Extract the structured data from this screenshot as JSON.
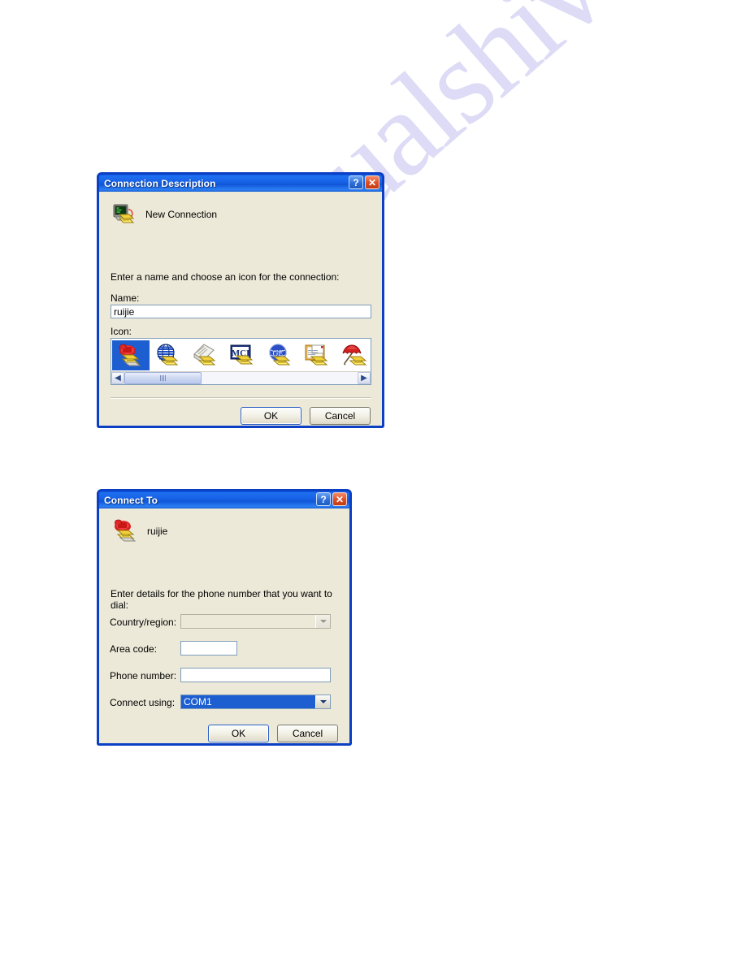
{
  "page": {
    "watermark": "manualshive.com",
    "background_color": "#ffffff"
  },
  "theme": {
    "titlebar_blue": "#1763e8",
    "dialog_face": "#ece9d8",
    "frame_blue": "#0b3fc4",
    "selection_blue": "#1d5fd0",
    "close_red": "#e0542a"
  },
  "dialogs": [
    {
      "title": "Connection Description",
      "titlebar_buttons": [
        {
          "name": "help-button",
          "glyph": "?"
        },
        {
          "name": "close-button",
          "glyph": "✕"
        }
      ],
      "header": {
        "icon": "new-connection-icon",
        "label": "New Connection"
      },
      "prompt": "Enter a name and choose an icon for the connection:",
      "fields": [
        {
          "label": "Name:",
          "type": "text",
          "value": "ruijie",
          "placeholder": ""
        }
      ],
      "icon_picker": {
        "label": "Icon:",
        "selected_index": 0,
        "icons": [
          {
            "name": "red-telephone-icon",
            "label": "Red telephone"
          },
          {
            "name": "globe-stripes-icon",
            "label": "Striped globe"
          },
          {
            "name": "fax-newspaper-icon",
            "label": "Fax document"
          },
          {
            "name": "mci-logo-icon",
            "label": "MCI"
          },
          {
            "name": "blue-globe-script-icon",
            "label": "Blue globe"
          },
          {
            "name": "documents-stack-icon",
            "label": "Documents"
          },
          {
            "name": "red-umbrella-icon",
            "label": "Red umbrella"
          }
        ],
        "scrollbar": {
          "left_arrow": "◀",
          "right_arrow": "▶",
          "thumb_position": "left"
        }
      },
      "buttons": [
        {
          "label": "OK",
          "name": "ok-button",
          "default": true
        },
        {
          "label": "Cancel",
          "name": "cancel-button",
          "default": false
        }
      ]
    },
    {
      "title": "Connect To",
      "titlebar_buttons": [
        {
          "name": "help-button",
          "glyph": "?"
        },
        {
          "name": "close-button",
          "glyph": "✕"
        }
      ],
      "header": {
        "icon": "red-telephone-icon",
        "label": "ruijie"
      },
      "prompt": "Enter details for the phone number that you want to dial:",
      "fields": [
        {
          "label": "Country/region:",
          "type": "combo",
          "value": "",
          "disabled": true,
          "selected": false
        },
        {
          "label": "Area code:",
          "type": "text",
          "value": "",
          "disabled": false,
          "selected": false
        },
        {
          "label": "Phone number:",
          "type": "text",
          "value": "",
          "disabled": false,
          "selected": false
        },
        {
          "label": "Connect using:",
          "type": "combo",
          "value": "COM1",
          "disabled": false,
          "selected": true
        }
      ],
      "buttons": [
        {
          "label": "OK",
          "name": "ok-button",
          "default": true
        },
        {
          "label": "Cancel",
          "name": "cancel-button",
          "default": false
        }
      ]
    }
  ]
}
